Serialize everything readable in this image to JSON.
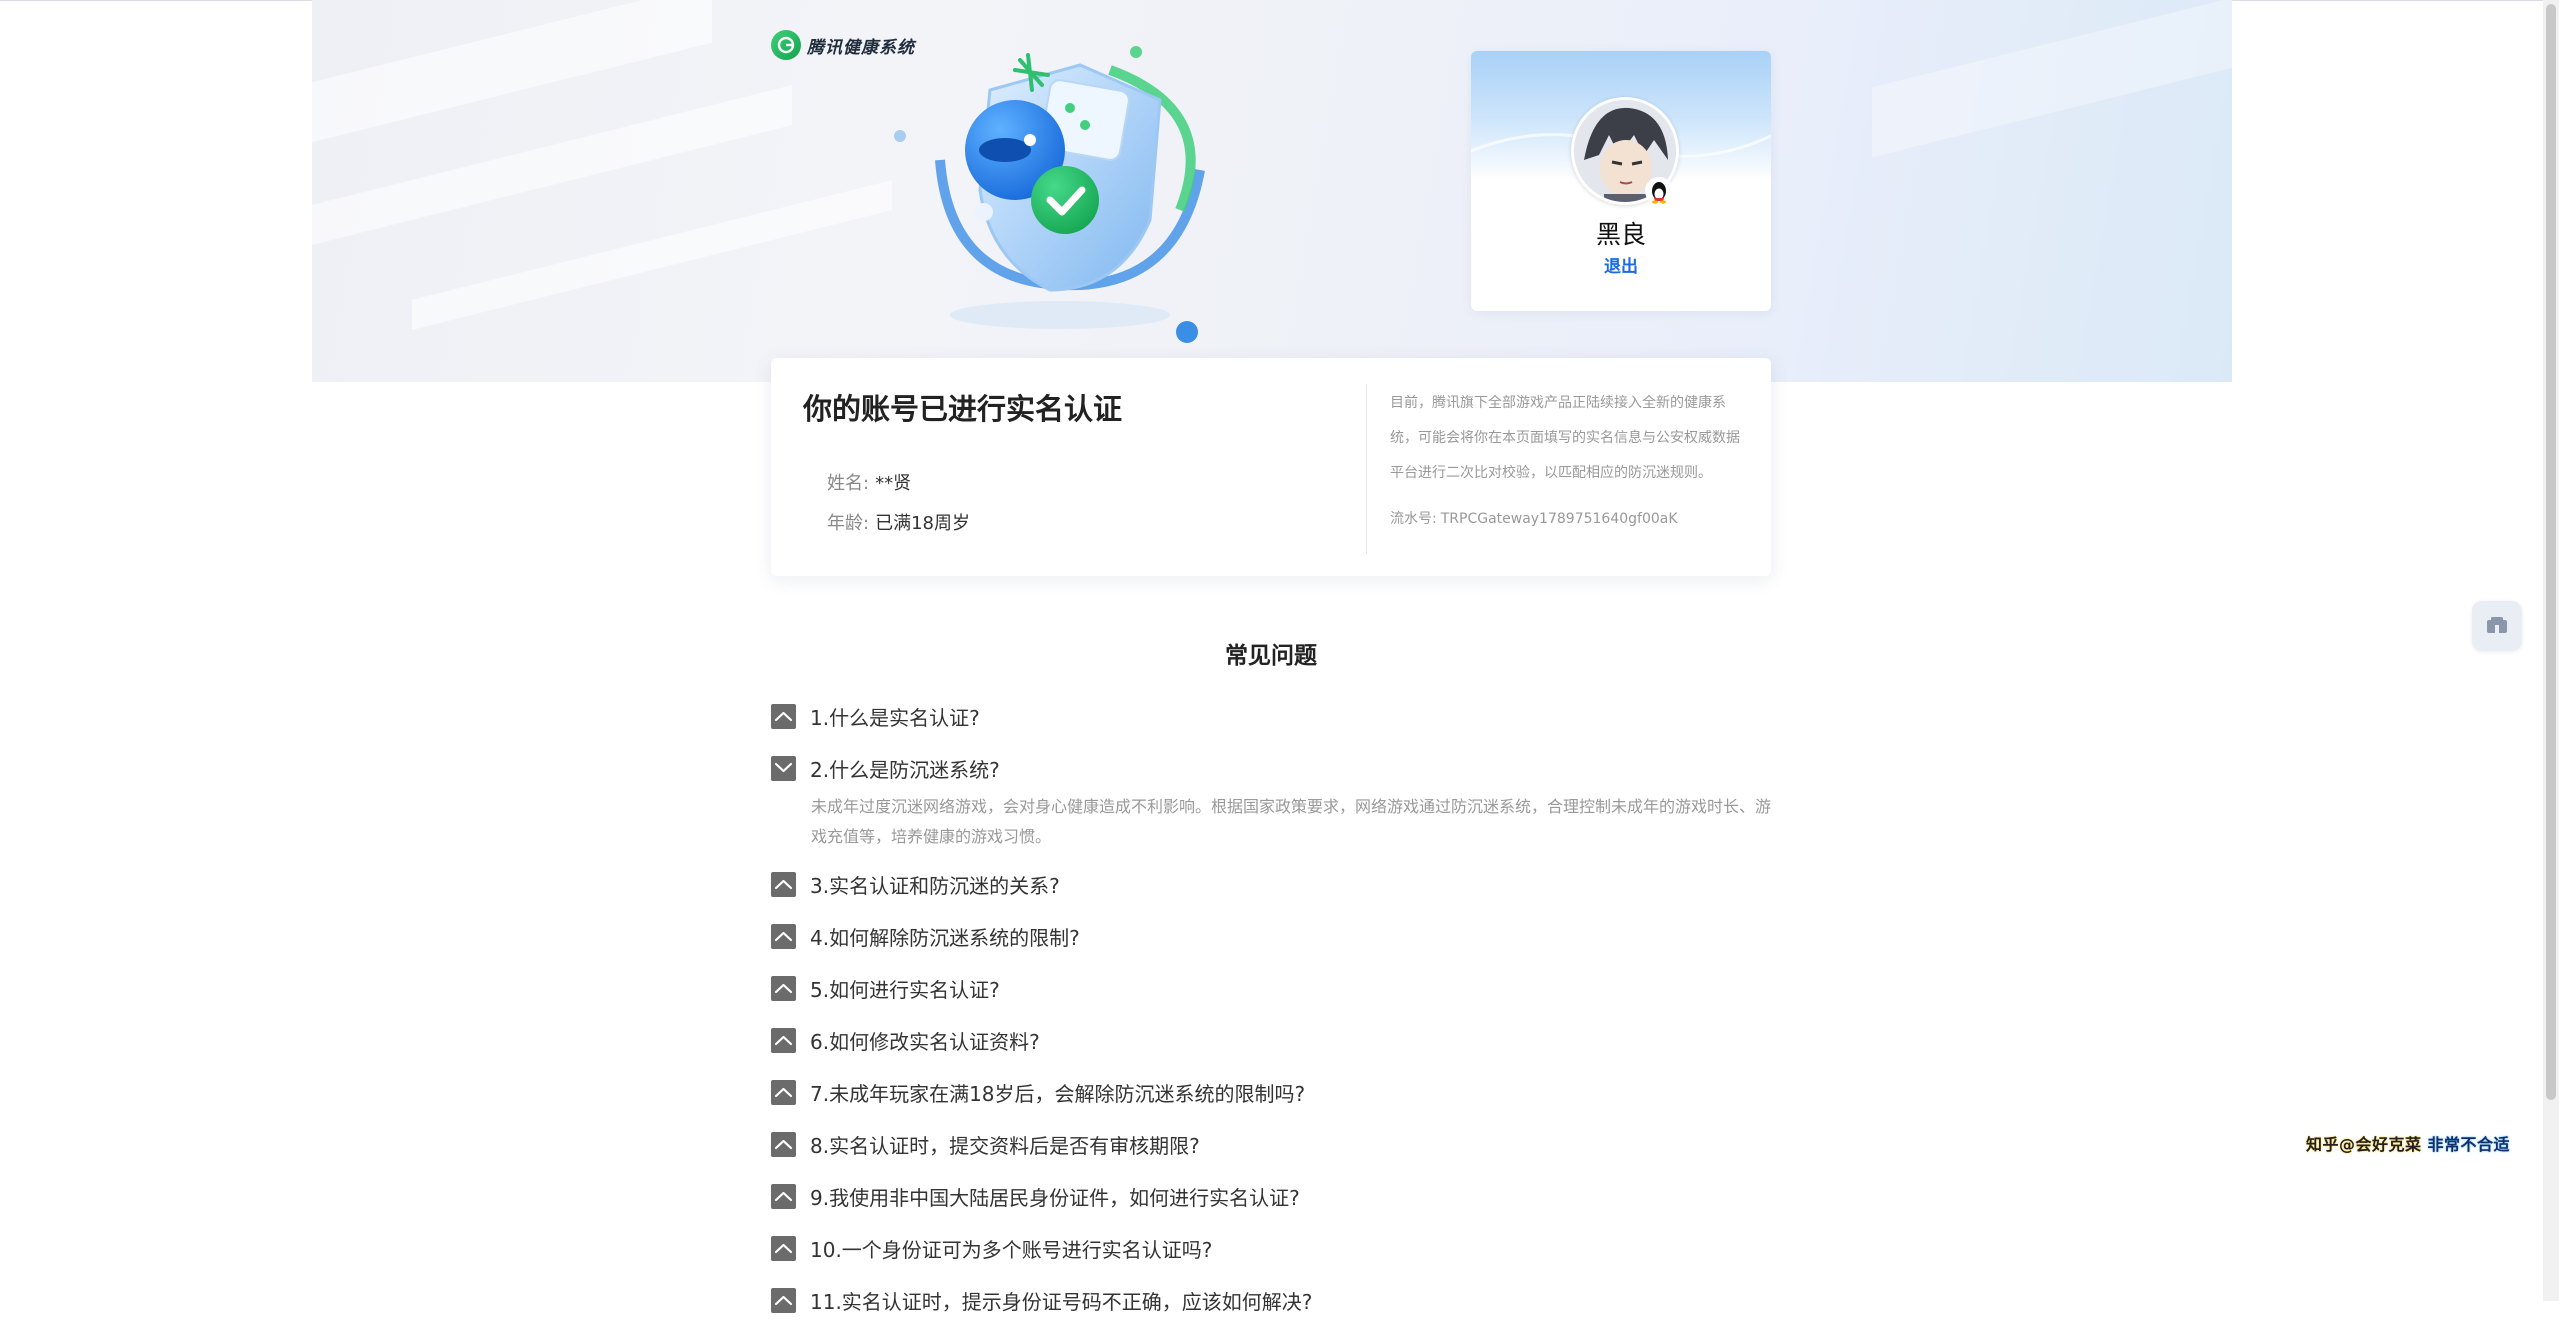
{
  "brand": {
    "name": "腾讯健康系统",
    "logo_icon": "shield-g-logo-icon",
    "logo_color": "#21b35a"
  },
  "profile": {
    "name": "黑良",
    "logout_label": "退出",
    "avatar_icon": "anime-avatar-icon",
    "badge_icon": "qq-penguin-icon",
    "link_color": "#1a6ae0"
  },
  "verification": {
    "title": "你的账号已进行实名认证",
    "name_label": "姓名:",
    "name_value": "**贤",
    "age_label": "年龄:",
    "age_value": "已满18周岁",
    "notice": "目前，腾讯旗下全部游戏产品正陆续接入全新的健康系统，可能会将你在本页面填写的实名信息与公安权威数据平台进行二次比对校验，以匹配相应的防沉迷规则。",
    "serial_label": "流水号:",
    "serial_value": "TRPCGateway1789751640gf00aK"
  },
  "faq": {
    "title": "常见问题",
    "items": [
      {
        "q": "1.什么是实名认证?",
        "expanded": false
      },
      {
        "q": "2.什么是防沉迷系统?",
        "expanded": true,
        "a": "未成年过度沉迷网络游戏，会对身心健康造成不利影响。根据国家政策要求，网络游戏通过防沉迷系统，合理控制未成年的游戏时长、游戏充值等，培养健康的游戏习惯。"
      },
      {
        "q": "3.实名认证和防沉迷的关系?",
        "expanded": false
      },
      {
        "q": "4.如何解除防沉迷系统的限制?",
        "expanded": false
      },
      {
        "q": "5.如何进行实名认证?",
        "expanded": false
      },
      {
        "q": "6.如何修改实名认证资料?",
        "expanded": false
      },
      {
        "q": "7.未成年玩家在满18岁后，会解除防沉迷系统的限制吗?",
        "expanded": false
      },
      {
        "q": "8.实名认证时，提交资料后是否有审核期限?",
        "expanded": false
      },
      {
        "q": "9.我使用非中国大陆居民身份证件，如何进行实名认证?",
        "expanded": false
      },
      {
        "q": "10.一个身份证可为多个账号进行实名认证吗?",
        "expanded": false
      },
      {
        "q": "11.实名认证时，提示身份证号码不正确，应该如何解决?",
        "expanded": false
      }
    ]
  },
  "side": {
    "float_icon": "feedback-icon"
  },
  "watermark": {
    "part1": "知乎@会好克菜",
    "part2": "非常不合适"
  }
}
